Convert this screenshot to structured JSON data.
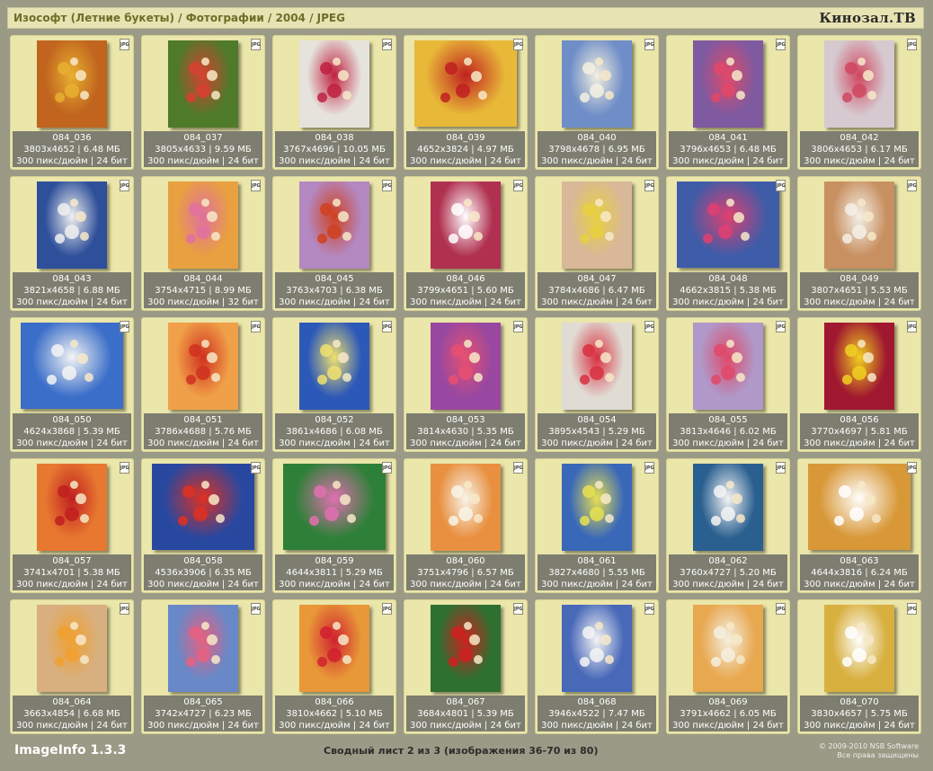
{
  "header": {
    "breadcrumb": "Изософт (Летние букеты) / Фотографии / 2004 / JPEG",
    "brand": "Кинозал.ТВ"
  },
  "tiles": [
    {
      "name": "084_036",
      "dims": "3803x4652 | 6.48 МБ",
      "res": "300 пикс/дюйм | 24 бит",
      "orient": "portrait",
      "bg": "#c0641e",
      "accent": "#e8b030"
    },
    {
      "name": "084_037",
      "dims": "3805x4633 | 9.59 МБ",
      "res": "300 пикс/дюйм | 24 бит",
      "orient": "portrait",
      "bg": "#4f7a2a",
      "accent": "#d84030"
    },
    {
      "name": "084_038",
      "dims": "3767x4696 | 10.05 МБ",
      "res": "300 пикс/дюйм | 24 бит",
      "orient": "portrait",
      "bg": "#e6e3dc",
      "accent": "#c02040"
    },
    {
      "name": "084_039",
      "dims": "4652x3824 | 4.97 МБ",
      "res": "300 пикс/дюйм | 24 бит",
      "orient": "landscape",
      "bg": "#e8b838",
      "accent": "#c02020"
    },
    {
      "name": "084_040",
      "dims": "3798x4678 | 6.95 МБ",
      "res": "300 пикс/дюйм | 24 бит",
      "orient": "portrait",
      "bg": "#6f8ec8",
      "accent": "#f4f0e0"
    },
    {
      "name": "084_041",
      "dims": "3796x4653 | 6.48 МБ",
      "res": "300 пикс/дюйм | 24 бит",
      "orient": "portrait",
      "bg": "#7f5aa0",
      "accent": "#e24868"
    },
    {
      "name": "084_042",
      "dims": "3806x4653 | 6.17 МБ",
      "res": "300 пикс/дюйм | 24 бит",
      "orient": "portrait",
      "bg": "#d6c9cf",
      "accent": "#d04660"
    },
    {
      "name": "084_043",
      "dims": "3821x4658 | 6.88 МБ",
      "res": "300 пикс/дюйм | 24 бит",
      "orient": "portrait",
      "bg": "#2e4f9a",
      "accent": "#f0f0f0"
    },
    {
      "name": "084_044",
      "dims": "3754x4715 | 8.99 МБ",
      "res": "300 пикс/дюйм | 32 бит",
      "orient": "portrait",
      "bg": "#e8a040",
      "accent": "#e070a0"
    },
    {
      "name": "084_045",
      "dims": "3763x4703 | 6.38 МБ",
      "res": "300 пикс/дюйм | 24 бит",
      "orient": "portrait",
      "bg": "#b488c0",
      "accent": "#d04020"
    },
    {
      "name": "084_046",
      "dims": "3799x4651 | 5.60 МБ",
      "res": "300 пикс/дюйм | 24 бит",
      "orient": "portrait",
      "bg": "#b03050",
      "accent": "#ffffff"
    },
    {
      "name": "084_047",
      "dims": "3784x4686 | 6.47 МБ",
      "res": "300 пикс/дюйм | 24 бит",
      "orient": "portrait",
      "bg": "#d8b898",
      "accent": "#e8d040"
    },
    {
      "name": "084_048",
      "dims": "4662x3815 | 5.38 МБ",
      "res": "300 пикс/дюйм | 24 бит",
      "orient": "landscape",
      "bg": "#3e5ca8",
      "accent": "#e04070"
    },
    {
      "name": "084_049",
      "dims": "3807x4651 | 5.53 МБ",
      "res": "300 пикс/дюйм | 24 бит",
      "orient": "portrait",
      "bg": "#c89060",
      "accent": "#f4f0e8"
    },
    {
      "name": "084_050",
      "dims": "4624x3868 | 5.39 МБ",
      "res": "300 пикс/дюйм | 24 бит",
      "orient": "landscape",
      "bg": "#3a6ec8",
      "accent": "#f4f4f4"
    },
    {
      "name": "084_051",
      "dims": "3786x4688 | 5.76 МБ",
      "res": "300 пикс/дюйм | 24 бит",
      "orient": "portrait",
      "bg": "#f0a048",
      "accent": "#d03020"
    },
    {
      "name": "084_052",
      "dims": "3861x4686 | 6.08 МБ",
      "res": "300 пикс/дюйм | 24 бит",
      "orient": "portrait",
      "bg": "#2c58b8",
      "accent": "#f0e070"
    },
    {
      "name": "084_053",
      "dims": "3814x4630 | 5.35 МБ",
      "res": "300 пикс/дюйм | 24 бит",
      "orient": "portrait",
      "bg": "#9848a0",
      "accent": "#e85070"
    },
    {
      "name": "084_054",
      "dims": "3895x4543 | 5.29 МБ",
      "res": "300 пикс/дюйм | 24 бит",
      "orient": "portrait",
      "bg": "#e0dcd4",
      "accent": "#d83040"
    },
    {
      "name": "084_055",
      "dims": "3813x4646 | 6.02 МБ",
      "res": "300 пикс/дюйм | 24 бит",
      "orient": "portrait",
      "bg": "#b098c8",
      "accent": "#e04868"
    },
    {
      "name": "084_056",
      "dims": "3770x4697 | 5.81 МБ",
      "res": "300 пикс/дюйм | 24 бит",
      "orient": "portrait",
      "bg": "#a01830",
      "accent": "#f0d020"
    },
    {
      "name": "084_057",
      "dims": "3741x4701 | 5.38 МБ",
      "res": "300 пикс/дюйм | 24 бит",
      "orient": "portrait",
      "bg": "#e87830",
      "accent": "#c02020"
    },
    {
      "name": "084_058",
      "dims": "4536x3906 | 6.35 МБ",
      "res": "300 пикс/дюйм | 24 бит",
      "orient": "landscape",
      "bg": "#2848a0",
      "accent": "#e03020"
    },
    {
      "name": "084_059",
      "dims": "4644x3811 | 5.29 МБ",
      "res": "300 пикс/дюйм | 24 бит",
      "orient": "landscape",
      "bg": "#2e8038",
      "accent": "#e070b0"
    },
    {
      "name": "084_060",
      "dims": "3751x4796 | 6.57 МБ",
      "res": "300 пикс/дюйм | 24 бит",
      "orient": "portrait",
      "bg": "#e89040",
      "accent": "#f8f4e8"
    },
    {
      "name": "084_061",
      "dims": "3827x4680 | 5.55 МБ",
      "res": "300 пикс/дюйм | 24 бит",
      "orient": "portrait",
      "bg": "#3a68b8",
      "accent": "#e8e050"
    },
    {
      "name": "084_062",
      "dims": "3760x4727 | 5.20 МБ",
      "res": "300 пикс/дюйм | 24 бит",
      "orient": "portrait",
      "bg": "#2a6090",
      "accent": "#f4f4f4"
    },
    {
      "name": "084_063",
      "dims": "4644x3816 | 6.24 МБ",
      "res": "300 пикс/дюйм | 24 бит",
      "orient": "landscape",
      "bg": "#d89838",
      "accent": "#ffffff"
    },
    {
      "name": "084_064",
      "dims": "3663x4854 | 6.68 МБ",
      "res": "300 пикс/дюйм | 24 бит",
      "orient": "portrait",
      "bg": "#d8b080",
      "accent": "#f0a030"
    },
    {
      "name": "084_065",
      "dims": "3742x4727 | 6.23 МБ",
      "res": "300 пикс/дюйм | 24 бит",
      "orient": "portrait",
      "bg": "#6888c8",
      "accent": "#e86080"
    },
    {
      "name": "084_066",
      "dims": "3810x4662 | 5.10 МБ",
      "res": "300 пикс/дюйм | 24 бит",
      "orient": "portrait",
      "bg": "#e89838",
      "accent": "#d02030"
    },
    {
      "name": "084_067",
      "dims": "3684x4801 | 5.39 МБ",
      "res": "300 пикс/дюйм | 24 бит",
      "orient": "portrait",
      "bg": "#2e7030",
      "accent": "#d02020"
    },
    {
      "name": "084_068",
      "dims": "3946x4522 | 7.47 МБ",
      "res": "300 пикс/дюйм | 24 бит",
      "orient": "portrait",
      "bg": "#4868b8",
      "accent": "#f4f4f4"
    },
    {
      "name": "084_069",
      "dims": "3791x4662 | 6.05 МБ",
      "res": "300 пикс/дюйм | 24 бит",
      "orient": "portrait",
      "bg": "#e8a850",
      "accent": "#f4f0e0"
    },
    {
      "name": "084_070",
      "dims": "3830x4657 | 5.75 МБ",
      "res": "300 пикс/дюйм | 24 бит",
      "orient": "portrait",
      "bg": "#d8b040",
      "accent": "#ffffff"
    }
  ],
  "file_badge": "JPG",
  "footer": {
    "app_name": "ImageInfo 1.3.3",
    "sheet_info": "Сводный лист 2 из 3 (изображения 36-70 из 80)",
    "copyright_line1": "© 2009-2010 NSB Software",
    "copyright_line2": "Все права защищены"
  }
}
